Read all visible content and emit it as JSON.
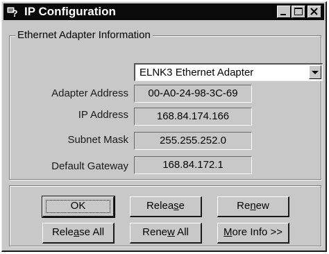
{
  "window": {
    "title": "IP Configuration"
  },
  "titlebar_buttons": [
    "minimize-icon",
    "maximize-icon",
    "close-icon"
  ],
  "group": {
    "legend": "Ethernet  Adapter Information"
  },
  "adapter_select": {
    "selected": "ELNK3 Ethernet Adapter"
  },
  "fields": {
    "adapter_address": {
      "label": "Adapter Address",
      "value": "00-A0-24-98-3C-69"
    },
    "ip_address": {
      "label": "IP Address",
      "value": "168.84.174.166"
    },
    "subnet_mask": {
      "label": "Subnet Mask",
      "value": "255.255.252.0"
    },
    "default_gateway": {
      "label": "Default Gateway",
      "value": "168.84.172.1"
    }
  },
  "buttons": {
    "ok": {
      "label": "OK"
    },
    "release": {
      "pre": "Relea",
      "accel": "s",
      "post": "e"
    },
    "renew": {
      "pre": "Re",
      "accel": "n",
      "post": "ew"
    },
    "release_all": {
      "pre": "Rele",
      "accel": "a",
      "post": "se All"
    },
    "renew_all": {
      "pre": "Rene",
      "accel": "w",
      "post": " All"
    },
    "more_info": {
      "pre": "",
      "accel": "M",
      "post": "ore Info >>"
    }
  },
  "colors": {
    "titlebar": "#0a0a0a",
    "face": "#c8c8c8"
  }
}
